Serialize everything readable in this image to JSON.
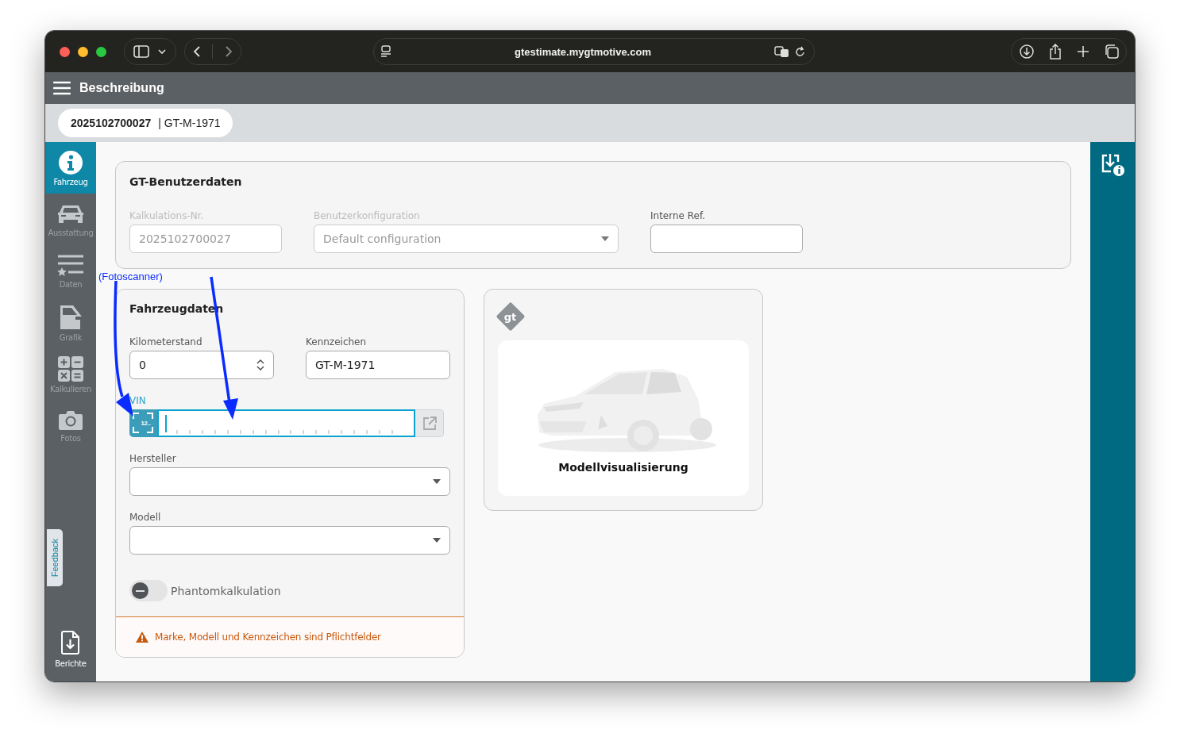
{
  "browser": {
    "url": "gtestimate.mygtmotive.com"
  },
  "header": {
    "title": "Beschreibung"
  },
  "record_tab": {
    "number": "2025102700027",
    "plate": "| GT-M-1971"
  },
  "sidebar": {
    "items": [
      {
        "label": "Fahrzeug",
        "selected": true
      },
      {
        "label": "Ausstattung",
        "selected": false
      },
      {
        "label": "Daten",
        "selected": false
      },
      {
        "label": "Grafik",
        "selected": false
      },
      {
        "label": "Kalkulieren",
        "selected": false
      },
      {
        "label": "Fotos",
        "selected": false
      }
    ],
    "feedback": "Feedback",
    "footer": {
      "label": "Berichte"
    }
  },
  "user_data": {
    "title": "GT-Benutzerdaten",
    "fields": [
      {
        "label": "Kalkulations-Nr.",
        "kind": "text",
        "value": "2025102700027",
        "disabled": true
      },
      {
        "label": "Benutzerkonfiguration",
        "kind": "select",
        "value": "Default configuration",
        "disabled": true
      },
      {
        "label": "Interne Ref.",
        "kind": "text",
        "disabled": false
      }
    ]
  },
  "vehicle_data": {
    "title": "Fahrzeugdaten",
    "fields": [
      {
        "label": "Kilometerstand",
        "kind": "number",
        "value": "0",
        "focused": false
      },
      {
        "label": "Kennzeichen",
        "kind": "text",
        "value": "GT-M-1971",
        "focused": false
      },
      {
        "label": "VIN",
        "kind": "vin",
        "scanner_label": "12..",
        "focused": true
      },
      {
        "label": "Hersteller",
        "kind": "select",
        "focused": false
      },
      {
        "label": "Modell",
        "kind": "select",
        "focused": false
      }
    ],
    "toggle": {
      "label": "Phantomkalkulation",
      "on": false
    },
    "warning": "Marke, Modell und Kennzeichen sind Pflichtfelder"
  },
  "model_card": {
    "logo": "gt",
    "title": "Modellvisualisierung"
  },
  "annotation": {
    "label": "(Fotoscanner)"
  }
}
